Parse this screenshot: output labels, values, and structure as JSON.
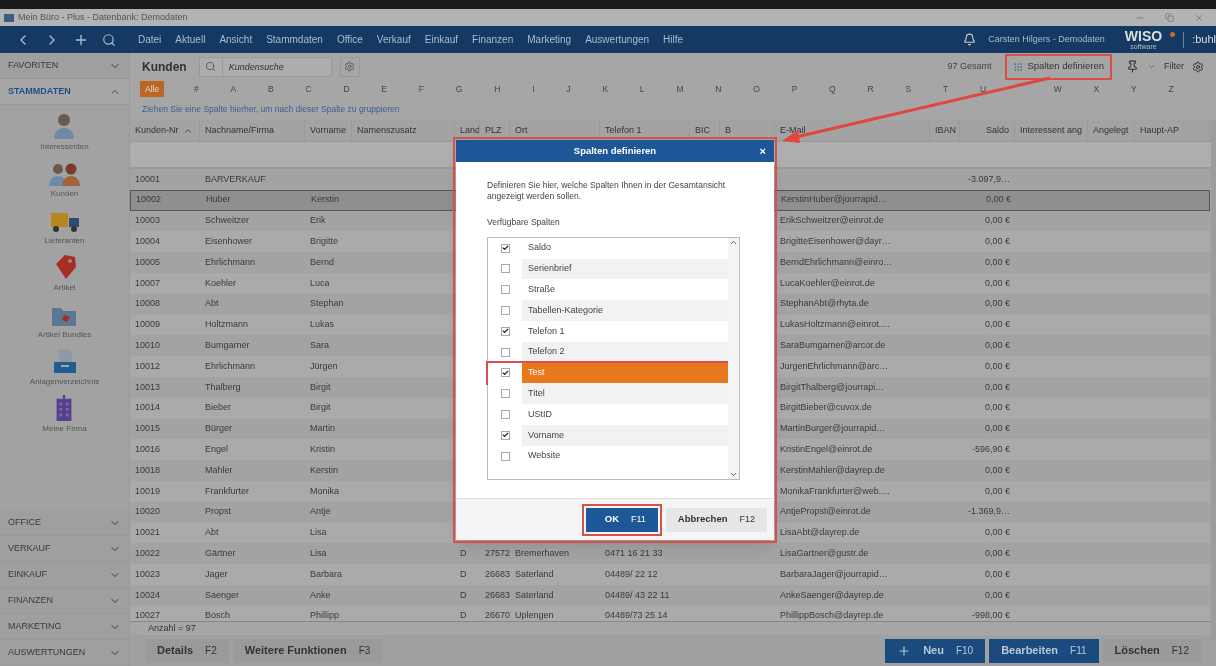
{
  "title_bar": {
    "title": "Mein Büro - Plus - Datenbank: Demodaten"
  },
  "nav": {
    "menu": [
      "Datei",
      "Aktuell",
      "Ansicht",
      "Stammdaten",
      "Office",
      "Verkauf",
      "Einkauf",
      "Finanzen",
      "Marketing",
      "Auswertungen",
      "Hilfe"
    ],
    "user": "Carsten Hilgers - Demodaten",
    "logo": "WISO",
    "logo_sub": "software",
    "brand": ":buhl"
  },
  "sidebar": {
    "sections": [
      {
        "label": "FAVORITEN",
        "expanded": false
      },
      {
        "label": "STAMMDATEN",
        "expanded": true,
        "items": [
          {
            "kind": "person",
            "label": "Interessenten"
          },
          {
            "kind": "people",
            "label": "Kunden"
          },
          {
            "kind": "truck",
            "label": "Lieferanten"
          },
          {
            "kind": "tag",
            "label": "Artikel"
          },
          {
            "kind": "folder",
            "label": "Artikel Bundles"
          },
          {
            "kind": "tray",
            "label": "Anlagenverzeichnis"
          },
          {
            "kind": "building",
            "label": "Meine Firma"
          }
        ]
      },
      {
        "label": "OFFICE",
        "expanded": false
      },
      {
        "label": "VERKAUF",
        "expanded": false
      },
      {
        "label": "EINKAUF",
        "expanded": false
      },
      {
        "label": "FINANZEN",
        "expanded": false
      },
      {
        "label": "MARKETING",
        "expanded": false
      },
      {
        "label": "AUSWERTUNGEN",
        "expanded": false
      }
    ]
  },
  "toolbar": {
    "title": "Kunden",
    "search_placeholder": "Kundensuche",
    "total": "97 Gesamt",
    "define_columns": "Spalten definieren",
    "filter": "Filter"
  },
  "alphabet": [
    {
      "label": "Alle",
      "selected": true
    },
    {
      "label": "#",
      "selected": false
    },
    {
      "label": "A",
      "selected": false
    },
    {
      "label": "B",
      "selected": false
    },
    {
      "label": "C",
      "selected": false
    },
    {
      "label": "D",
      "selected": false
    },
    {
      "label": "E",
      "selected": false
    },
    {
      "label": "F",
      "selected": false
    },
    {
      "label": "G",
      "selected": false
    },
    {
      "label": "H",
      "selected": false
    },
    {
      "label": "I",
      "selected": false
    },
    {
      "label": "J",
      "selected": false
    },
    {
      "label": "K",
      "selected": false
    },
    {
      "label": "L",
      "selected": false
    },
    {
      "label": "M",
      "selected": false
    },
    {
      "label": "N",
      "selected": false
    },
    {
      "label": "O",
      "selected": false
    },
    {
      "label": "P",
      "selected": false
    },
    {
      "label": "Q",
      "selected": false
    },
    {
      "label": "R",
      "selected": false
    },
    {
      "label": "S",
      "selected": false
    },
    {
      "label": "T",
      "selected": false
    },
    {
      "label": "U",
      "selected": false
    },
    {
      "label": "W",
      "selected": false
    },
    {
      "label": "X",
      "selected": false
    },
    {
      "label": "Y",
      "selected": false
    },
    {
      "label": "Z",
      "selected": false
    }
  ],
  "group_hint": "Ziehen Sie eine Spalte hierher, um nach dieser Spalte zu gruppieren",
  "table": {
    "columns": [
      {
        "label": "Kunden-Nr",
        "sorted": true
      },
      {
        "label": "Nachname/Firma"
      },
      {
        "label": "Vorname"
      },
      {
        "label": "Namenszusatz"
      },
      {
        "label": "Land"
      },
      {
        "label": "PLZ"
      },
      {
        "label": "Ort"
      },
      {
        "label": "Telefon 1"
      },
      {
        "label": "BIC"
      },
      {
        "label": "B"
      },
      {
        "label": "E-Mail"
      },
      {
        "label": "IBAN"
      },
      {
        "label": "Saldo"
      },
      {
        "label": "Interessent ang"
      },
      {
        "label": "Angelegt"
      },
      {
        "label": "Haupt-AP"
      }
    ],
    "rows": [
      {
        "selected": false,
        "cells": [
          "10001",
          "BARVERKAUF",
          null,
          null,
          null,
          null,
          null,
          null,
          null,
          null,
          null,
          null,
          "-3.097,9…",
          null,
          null,
          null
        ]
      },
      {
        "selected": true,
        "cells": [
          "10002",
          "Huber",
          "Kerstin",
          null,
          null,
          null,
          null,
          null,
          null,
          null,
          "KerstinHuber@jourrapid…",
          null,
          "0,00 €",
          null,
          null,
          null
        ]
      },
      {
        "selected": false,
        "cells": [
          "10003",
          "Schweitzer",
          "Erik",
          null,
          null,
          null,
          null,
          null,
          null,
          null,
          "ErikSchweitzer@einrot.de",
          null,
          "0,00 €",
          null,
          null,
          null
        ]
      },
      {
        "selected": false,
        "cells": [
          "10004",
          "Eisenhower",
          "Brigitte",
          null,
          null,
          null,
          null,
          null,
          null,
          null,
          "BrigitteEisenhower@dayr…",
          null,
          "0,00 €",
          null,
          null,
          null
        ]
      },
      {
        "selected": false,
        "cells": [
          "10005",
          "Ehrlichmann",
          "Bernd",
          null,
          null,
          null,
          null,
          null,
          null,
          null,
          "BerndEhrlichmann@einro…",
          null,
          "0,00 €",
          null,
          null,
          null
        ]
      },
      {
        "selected": false,
        "cells": [
          "10007",
          "Koehler",
          "Luca",
          null,
          null,
          null,
          null,
          null,
          null,
          null,
          "LucaKoehler@einrot.de",
          null,
          "0,00 €",
          null,
          null,
          null
        ]
      },
      {
        "selected": false,
        "cells": [
          "10008",
          "Abt",
          "Stephan",
          null,
          null,
          null,
          null,
          null,
          null,
          null,
          "StephanAbt@rhyta.de",
          null,
          "0,00 €",
          null,
          null,
          null
        ]
      },
      {
        "selected": false,
        "cells": [
          "10009",
          "Holtzmann",
          "Lukas",
          null,
          null,
          null,
          null,
          null,
          null,
          null,
          "LukasHoltzmann@einrot.…",
          null,
          "0,00 €",
          null,
          null,
          null
        ]
      },
      {
        "selected": false,
        "cells": [
          "10010",
          "Bumgarner",
          "Sara",
          null,
          null,
          null,
          null,
          null,
          null,
          null,
          "SaraBumgarner@arcor.de",
          null,
          "0,00 €",
          null,
          null,
          null
        ]
      },
      {
        "selected": false,
        "cells": [
          "10012",
          "Ehrlichmann",
          "Jürgen",
          null,
          null,
          null,
          null,
          null,
          null,
          null,
          "JurgenEhrlichmann@arc…",
          null,
          "0,00 €",
          null,
          null,
          null
        ]
      },
      {
        "selected": false,
        "cells": [
          "10013",
          "Thalberg",
          "Birgit",
          null,
          null,
          null,
          null,
          null,
          null,
          null,
          "BirgitThalberg@jourrapi…",
          null,
          "0,00 €",
          null,
          null,
          null
        ]
      },
      {
        "selected": false,
        "cells": [
          "10014",
          "Bieber",
          "Birgit",
          null,
          null,
          null,
          null,
          null,
          null,
          null,
          "BirgitBieber@cuvox.de",
          null,
          "0,00 €",
          null,
          null,
          null
        ]
      },
      {
        "selected": false,
        "cells": [
          "10015",
          "Bürger",
          "Martin",
          null,
          null,
          null,
          null,
          null,
          null,
          null,
          "MartinBurger@jourrapid…",
          null,
          "0,00 €",
          null,
          null,
          null
        ]
      },
      {
        "selected": false,
        "cells": [
          "10016",
          "Engel",
          "Kristin",
          null,
          null,
          null,
          null,
          null,
          null,
          null,
          "KristinEngel@einrot.de",
          null,
          "-596,90 €",
          null,
          null,
          null
        ]
      },
      {
        "selected": false,
        "cells": [
          "10018",
          "Mahler",
          "Kerstin",
          null,
          null,
          null,
          null,
          null,
          null,
          null,
          "KerstinMahler@dayrep.de",
          null,
          "0,00 €",
          null,
          null,
          null
        ]
      },
      {
        "selected": false,
        "cells": [
          "10019",
          "Frankfurter",
          "Monika",
          null,
          null,
          null,
          null,
          null,
          null,
          null,
          "MonikaFrankfurter@web.…",
          null,
          "0,00 €",
          null,
          null,
          null
        ]
      },
      {
        "selected": false,
        "cells": [
          "10020",
          "Propst",
          "Antje",
          null,
          null,
          null,
          null,
          null,
          null,
          null,
          "AntjePropst@einrot.de",
          null,
          "-1.369,9…",
          null,
          null,
          null
        ]
      },
      {
        "selected": false,
        "cells": [
          "10021",
          "Abt",
          "Lisa",
          null,
          null,
          null,
          null,
          null,
          null,
          null,
          "LisaAbt@dayrep.de",
          null,
          "0,00 €",
          null,
          null,
          null
        ]
      },
      {
        "selected": false,
        "cells": [
          "10022",
          "Gärtner",
          "Lisa",
          null,
          "D",
          "27572",
          "Bremerhaven",
          "0471 16 21 33",
          null,
          null,
          "LisaGartner@gustr.de",
          null,
          "0,00 €",
          null,
          null,
          null
        ]
      },
      {
        "selected": false,
        "cells": [
          "10023",
          "Jager",
          "Barbara",
          null,
          "D",
          "26683",
          "Saterland",
          "04489/ 22 12",
          null,
          null,
          "BarbaraJager@jourrapid…",
          null,
          "0,00 €",
          null,
          null,
          null
        ]
      },
      {
        "selected": false,
        "cells": [
          "10024",
          "Saenger",
          "Anke",
          null,
          "D",
          "26683",
          "Saterland",
          "04489/ 43 22 11",
          null,
          null,
          "AnkeSaenger@dayrep.de",
          null,
          "0,00 €",
          null,
          null,
          null
        ]
      },
      {
        "selected": false,
        "cells": [
          "10027",
          "Bosch",
          "Phillipp",
          null,
          "D",
          "26670",
          "Uplengen",
          "04489/73 25 14",
          null,
          null,
          "PhillippBosch@dayrep.de",
          null,
          "-998,00 €",
          null,
          null,
          null
        ]
      }
    ],
    "count": "Anzahl = 97"
  },
  "bottom_buttons": [
    {
      "kind": "plain",
      "label": "Details",
      "key": "F2"
    },
    {
      "kind": "plain",
      "label": "Weitere Funktionen",
      "key": "F3"
    }
  ],
  "action_buttons": [
    {
      "kind": "primary",
      "label": "Neu",
      "key": "F10",
      "plus": true
    },
    {
      "kind": "primary",
      "label": "Bearbeiten",
      "key": "F11"
    },
    {
      "kind": "plain",
      "label": "Löschen",
      "key": "F12"
    }
  ],
  "dialog": {
    "title": "Spalten definieren",
    "close": "×",
    "text": "Definieren Sie hier, welche Spalten Ihnen in der Gesamtansicht angezeigt werden sollen.",
    "list_label": "Verfügbare Spalten",
    "items": [
      {
        "label": "Saldo",
        "checked": true,
        "selected": false
      },
      {
        "label": "Serienbrief",
        "checked": false,
        "selected": false
      },
      {
        "label": "Straße",
        "checked": false,
        "selected": false
      },
      {
        "label": "Tabellen-Kategorie",
        "checked": false,
        "selected": false
      },
      {
        "label": "Telefon 1",
        "checked": true,
        "selected": false
      },
      {
        "label": "Telefon 2",
        "checked": false,
        "selected": false
      },
      {
        "label": "Test",
        "checked": true,
        "selected": true
      },
      {
        "label": "Titel",
        "checked": false,
        "selected": false
      },
      {
        "label": "UStID",
        "checked": false,
        "selected": false
      },
      {
        "label": "Vorname",
        "checked": true,
        "selected": false
      },
      {
        "label": "Website",
        "checked": false,
        "selected": false
      }
    ],
    "buttons": [
      {
        "kind": "primary",
        "label": "OK",
        "key": "F11"
      },
      {
        "kind": "plain",
        "label": "Abbrechen",
        "key": "F12"
      }
    ]
  }
}
